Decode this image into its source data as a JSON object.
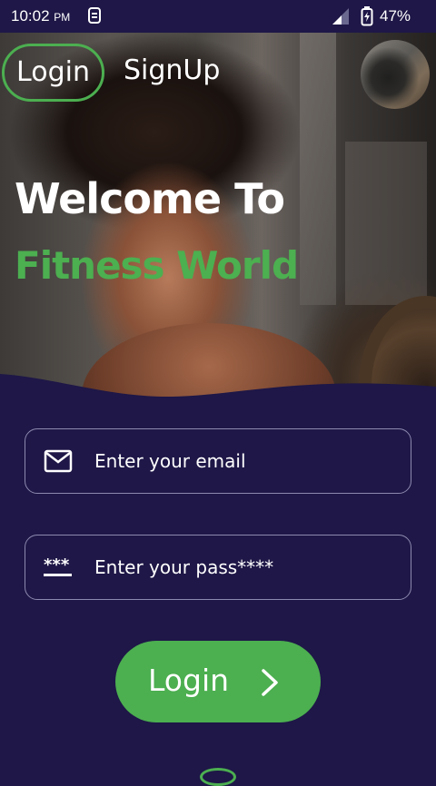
{
  "status_bar": {
    "time": "10:02",
    "ampm": "PM",
    "battery_pct": "47%",
    "icons": [
      "sim-icon",
      "signal-icon",
      "battery-charging-icon"
    ]
  },
  "tabs": {
    "login_label": "Login",
    "signup_label": "SignUp"
  },
  "hero": {
    "welcome_line": "Welcome To",
    "brand_line": "Fitness World"
  },
  "form": {
    "email_placeholder": "Enter your email",
    "email_value": "",
    "password_placeholder": "Enter your pass****",
    "password_value": "",
    "email_icon": "mail-icon",
    "password_icon": "password-icon"
  },
  "submit": {
    "label": "Login",
    "icon": "chevron-right-icon"
  },
  "colors": {
    "background": "#1e1747",
    "accent": "#4caf50",
    "text": "#ffffff",
    "field_border": "#8d8ab0"
  }
}
